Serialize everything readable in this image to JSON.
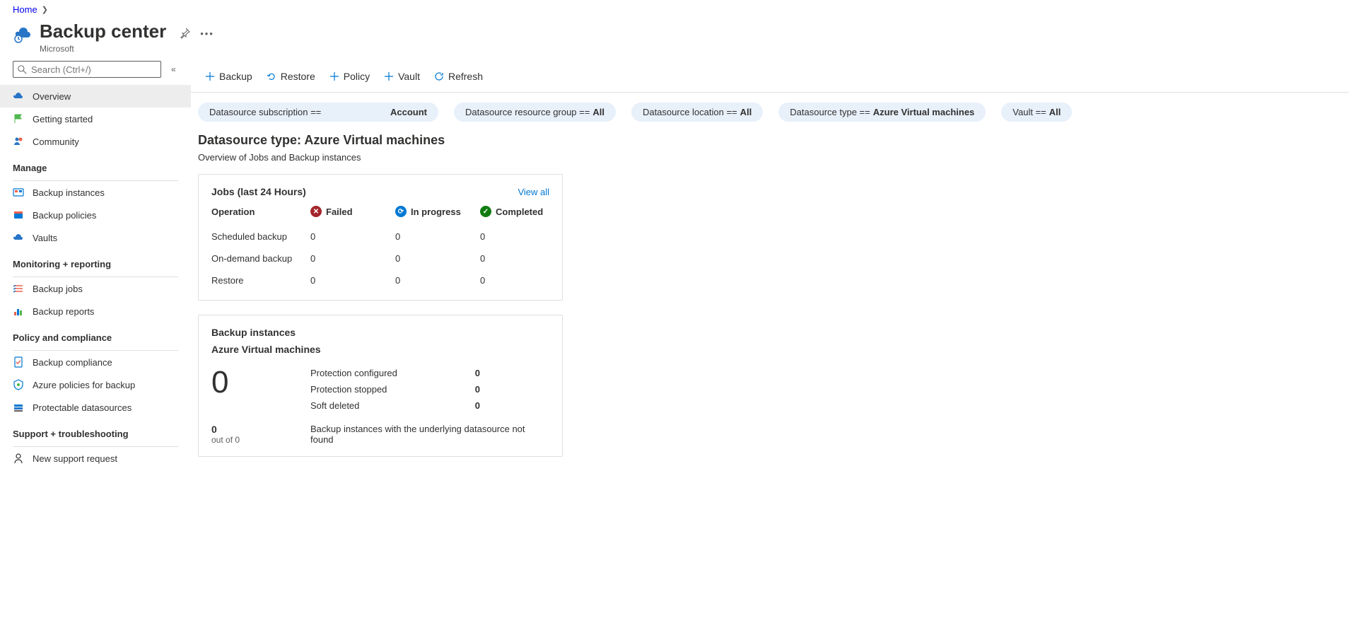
{
  "breadcrumb": {
    "home": "Home"
  },
  "header": {
    "title": "Backup center",
    "subtitle": "Microsoft"
  },
  "search": {
    "placeholder": "Search (Ctrl+/)"
  },
  "sidebar": {
    "items": {
      "overview": "Overview",
      "getting_started": "Getting started",
      "community": "Community",
      "backup_instances": "Backup instances",
      "backup_policies": "Backup policies",
      "vaults": "Vaults",
      "backup_jobs": "Backup jobs",
      "backup_reports": "Backup reports",
      "backup_compliance": "Backup compliance",
      "azure_policies": "Azure policies for backup",
      "protectable_ds": "Protectable datasources",
      "new_support": "New support request"
    },
    "sections": {
      "manage": "Manage",
      "monitoring": "Monitoring + reporting",
      "policy": "Policy and compliance",
      "support": "Support + troubleshooting"
    }
  },
  "toolbar": {
    "backup": "Backup",
    "restore": "Restore",
    "policy": "Policy",
    "vault": "Vault",
    "refresh": "Refresh"
  },
  "filters": {
    "subscription": {
      "label": "Datasource subscription ==",
      "value": "Account"
    },
    "resource_group": {
      "label": "Datasource resource group ==",
      "value": "All"
    },
    "location": {
      "label": "Datasource location ==",
      "value": "All"
    },
    "type": {
      "label": "Datasource type ==",
      "value": "Azure Virtual machines"
    },
    "vault": {
      "label": "Vault ==",
      "value": "All"
    }
  },
  "main": {
    "title": "Datasource type: Azure Virtual machines",
    "subtitle": "Overview of Jobs and Backup instances"
  },
  "jobs_card": {
    "title": "Jobs (last 24 Hours)",
    "view_all": "View all",
    "col_operation": "Operation",
    "col_failed": "Failed",
    "col_in_progress": "In progress",
    "col_completed": "Completed",
    "rows": {
      "scheduled": {
        "label": "Scheduled backup",
        "failed": "0",
        "in_progress": "0",
        "completed": "0"
      },
      "on_demand": {
        "label": "On-demand backup",
        "failed": "0",
        "in_progress": "0",
        "completed": "0"
      },
      "restore": {
        "label": "Restore",
        "failed": "0",
        "in_progress": "0",
        "completed": "0"
      }
    }
  },
  "bi_card": {
    "title": "Backup instances",
    "subtitle": "Azure Virtual machines",
    "total": "0",
    "protection_configured": {
      "label": "Protection configured",
      "value": "0"
    },
    "protection_stopped": {
      "label": "Protection stopped",
      "value": "0"
    },
    "soft_deleted": {
      "label": "Soft deleted",
      "value": "0"
    },
    "not_found_count": "0",
    "not_found_outof": "out of 0",
    "not_found_desc": "Backup instances with the underlying datasource not found"
  }
}
